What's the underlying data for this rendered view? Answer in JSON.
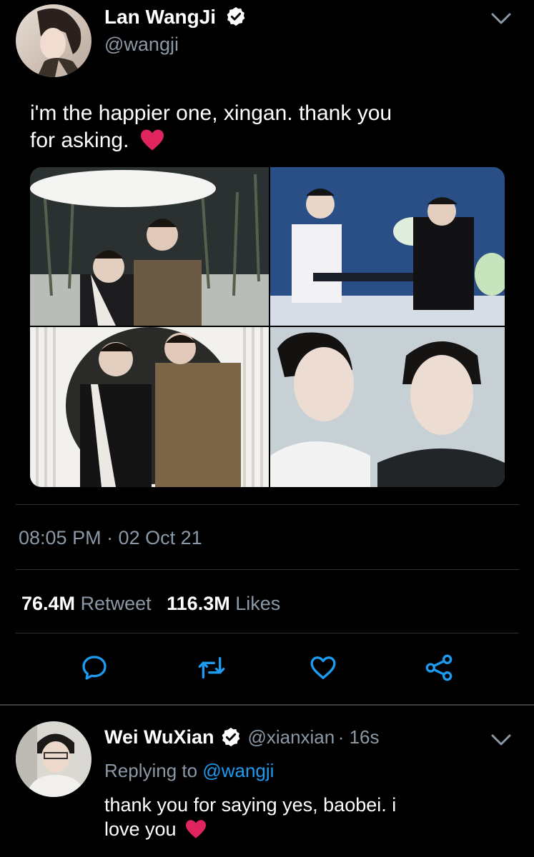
{
  "tweet": {
    "author": {
      "name": "Lan WangJi",
      "handle": "@wangji",
      "verified": true
    },
    "text_line1": "i'm the happier one, xingan. thank you",
    "text_line2": "for asking.",
    "emoji": "heart-emoji",
    "timestamp": "08:05 PM · 02 Oct 21",
    "stats": {
      "retweets_count": "76.4M",
      "retweets_label": "Retweet",
      "likes_count": "116.3M",
      "likes_label": "Likes"
    },
    "photos": [
      "bamboo-umbrella-photo",
      "guqin-blue-photo",
      "circle-frame-photo",
      "portrait-duo-photo"
    ]
  },
  "actions": [
    "reply-icon",
    "retweet-icon",
    "like-icon",
    "share-icon"
  ],
  "reply": {
    "author": {
      "name": "Wei WuXian",
      "handle": "@xianxian",
      "time": "· 16s",
      "verified": true
    },
    "replying_prefix": "Replying to",
    "replying_handle": "@wangji",
    "text_line1": "thank you for saying yes, baobei. i",
    "text_line2": "love you"
  },
  "colors": {
    "background": "#000000",
    "muted": "#8b98a5",
    "link": "#1d9bf0",
    "heart": "#e0245e"
  }
}
